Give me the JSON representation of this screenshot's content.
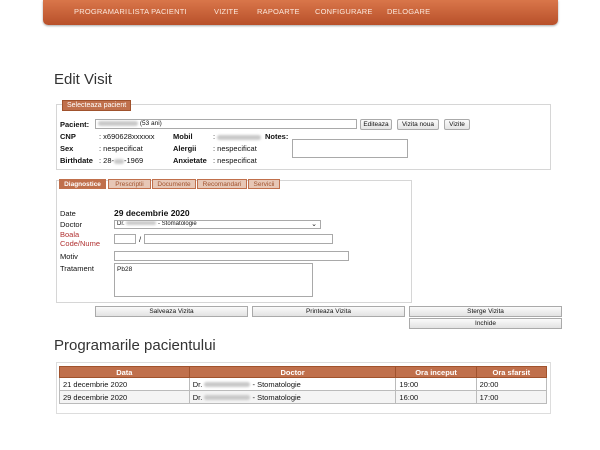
{
  "nav": [
    "PROGRAMARI",
    "LISTA PACIENTI",
    "VIZITE",
    "RAPOARTE",
    "CONFIGURARE",
    "DELOGARE"
  ],
  "page_title": "Edit Visit",
  "patient_panel": {
    "legend": "Selecteaza pacient",
    "pacient_label": "Pacient:",
    "pacient_age": "(53 ani)",
    "buttons": [
      "Editeaza",
      "Vizita noua",
      "Vizite"
    ],
    "cnp_label": "CNP",
    "cnp_value": ": x690628xxxxxx",
    "sex_label": "Sex",
    "sex_value": ": nespecificat",
    "birth_label": "Birthdate",
    "birth_value_pre": ": 28-",
    "birth_value_post": "-1969",
    "mobil_label": "Mobil",
    "mobil_value": ":",
    "alergii_label": "Alergii",
    "alergii_value": ": nespecificat",
    "anxietate_label": "Anxietate",
    "anxietate_value": ": nespecificat",
    "notes_label": "Notes:"
  },
  "visit_tabs": [
    "Diagnostice",
    "Prescriptii",
    "Documente",
    "Recomandari",
    "Servicii"
  ],
  "visit_form": {
    "date_label": "Date",
    "date_value": "29 decembrie 2020",
    "doctor_label": "Doctor",
    "doctor_value_pre": "Dr.",
    "doctor_value_post": "- Stomatologie",
    "boala_label": "Boala Code/Nume",
    "boala_sep": "/",
    "motiv_label": "Motiv",
    "tratament_label": "Tratament",
    "tratament_value": "Pb28"
  },
  "actions": {
    "save": "Salveaza Vizita",
    "print": "Printeaza Vizita",
    "delete": "Sterge Vizita",
    "close": "Inchide"
  },
  "appointments": {
    "title": "Programarile pacientului",
    "headers": [
      "Data",
      "Doctor",
      "Ora inceput",
      "Ora sfarsit"
    ],
    "rows": [
      {
        "data": "21 decembrie 2020",
        "doctor_pre": "Dr.",
        "doctor_post": "- Stomatologie",
        "start": "19:00",
        "end": "20:00"
      },
      {
        "data": "29 decembrie 2020",
        "doctor_pre": "Dr.",
        "doctor_post": "- Stomatologie",
        "start": "16:00",
        "end": "17:00"
      }
    ]
  },
  "colors": {
    "accent": "#c0704c",
    "accent_dark": "#a0522d",
    "nav_top": "#d9764a",
    "label_red": "#b03030"
  }
}
